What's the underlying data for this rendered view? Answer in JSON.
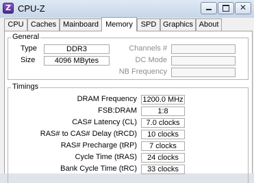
{
  "window": {
    "title": "CPU-Z",
    "icon_glyph": "Z"
  },
  "tabs": [
    {
      "label": "CPU"
    },
    {
      "label": "Caches"
    },
    {
      "label": "Mainboard"
    },
    {
      "label": "Memory",
      "active": true
    },
    {
      "label": "SPD"
    },
    {
      "label": "Graphics"
    },
    {
      "label": "About"
    }
  ],
  "general": {
    "title": "General",
    "type_label": "Type",
    "type_value": "DDR3",
    "size_label": "Size",
    "size_value": "4096 MBytes",
    "channels_label": "Channels #",
    "channels_value": "",
    "dc_mode_label": "DC Mode",
    "dc_mode_value": "",
    "nb_freq_label": "NB Frequency",
    "nb_freq_value": ""
  },
  "timings": {
    "title": "Timings",
    "rows": [
      {
        "label": "DRAM Frequency",
        "value": "1200.0 MHz"
      },
      {
        "label": "FSB:DRAM",
        "value": "1:8"
      },
      {
        "label": "CAS# Latency (CL)",
        "value": "7.0 clocks"
      },
      {
        "label": "RAS# to CAS# Delay (tRCD)",
        "value": "10 clocks"
      },
      {
        "label": "RAS# Precharge (tRP)",
        "value": "7 clocks"
      },
      {
        "label": "Cycle Time (tRAS)",
        "value": "24 clocks"
      },
      {
        "label": "Bank Cycle Time (tRC)",
        "value": "33 clocks"
      }
    ]
  },
  "colors": {
    "titlebar": "#c6d5e8",
    "dim_text": "#8c8c8c"
  },
  "icons": [
    "cpuz-app-icon",
    "minimize-icon",
    "maximize-icon",
    "close-icon"
  ]
}
